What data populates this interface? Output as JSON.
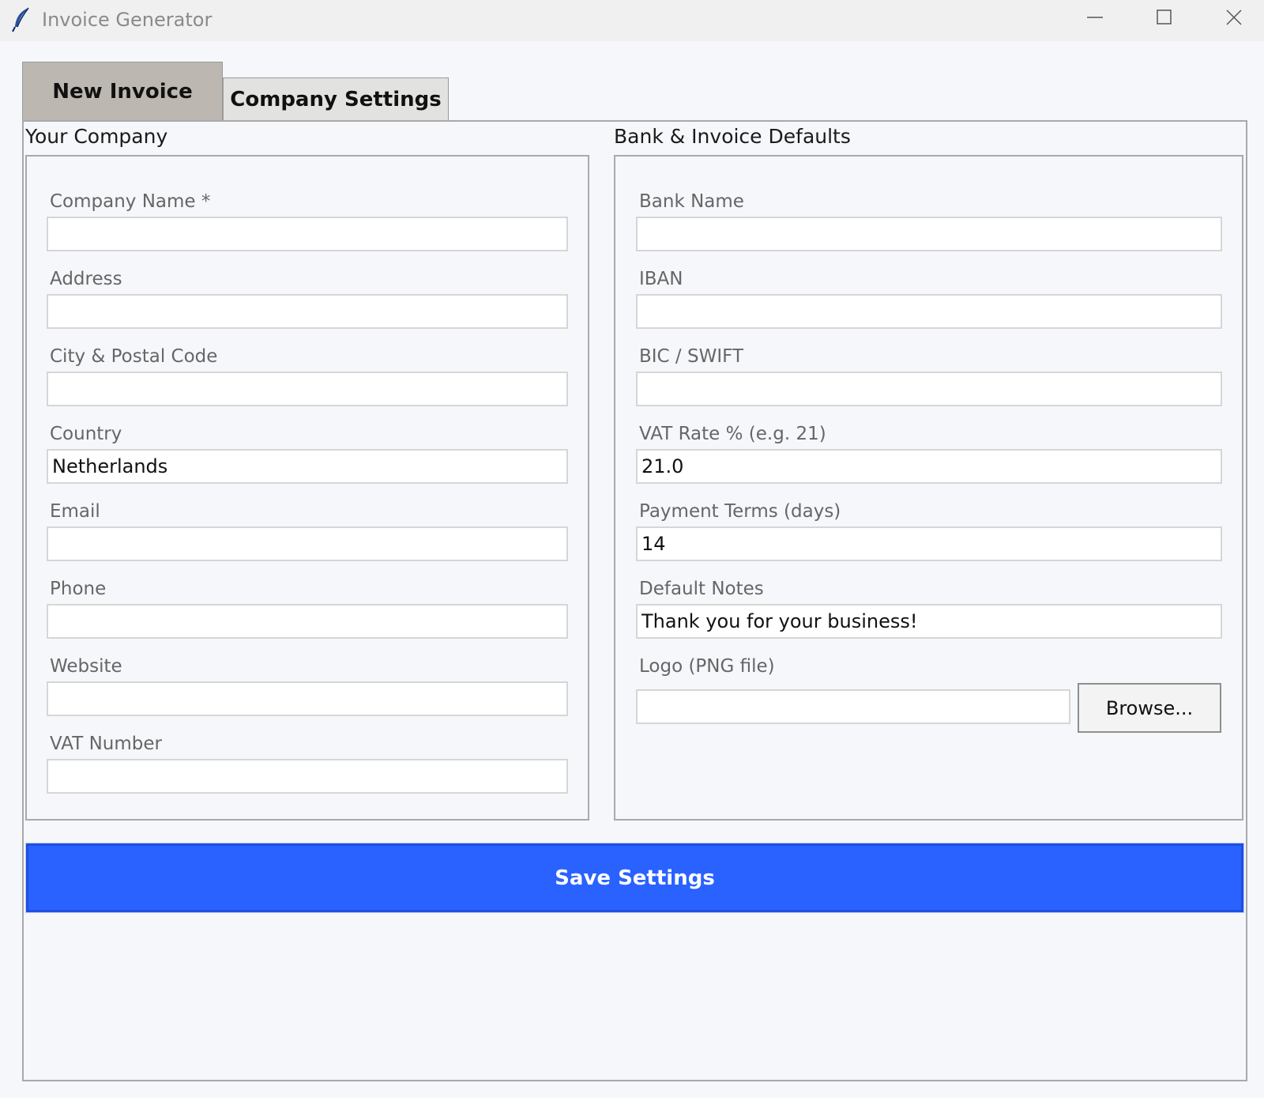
{
  "window": {
    "title": "Invoice Generator"
  },
  "tabs": [
    {
      "label": "New Invoice",
      "selected": false
    },
    {
      "label": "Company Settings",
      "selected": true
    }
  ],
  "company_section": {
    "title": "Your Company",
    "fields": [
      {
        "label": "Company Name *",
        "value": ""
      },
      {
        "label": "Address",
        "value": ""
      },
      {
        "label": "City & Postal Code",
        "value": ""
      },
      {
        "label": "Country",
        "value": "Netherlands"
      },
      {
        "label": "Email",
        "value": ""
      },
      {
        "label": "Phone",
        "value": ""
      },
      {
        "label": "Website",
        "value": ""
      },
      {
        "label": "VAT Number",
        "value": ""
      }
    ]
  },
  "bank_section": {
    "title": "Bank & Invoice Defaults",
    "fields": [
      {
        "label": "Bank Name",
        "value": ""
      },
      {
        "label": "IBAN",
        "value": ""
      },
      {
        "label": "BIC / SWIFT",
        "value": ""
      },
      {
        "label": "VAT Rate % (e.g. 21)",
        "value": "21.0"
      },
      {
        "label": "Payment Terms (days)",
        "value": "14"
      },
      {
        "label": "Default Notes",
        "value": "Thank you for your business!"
      },
      {
        "label": "Logo (PNG file)",
        "value": ""
      }
    ],
    "browse_label": "Browse..."
  },
  "save_label": "Save Settings",
  "colors": {
    "accent": "#2962ff",
    "background": "#f5f7fb",
    "tab_selected": "#bcb8b1"
  },
  "icons": {
    "app": "feather-icon",
    "minimize": "minimize-icon",
    "maximize": "maximize-icon",
    "close": "close-icon"
  }
}
